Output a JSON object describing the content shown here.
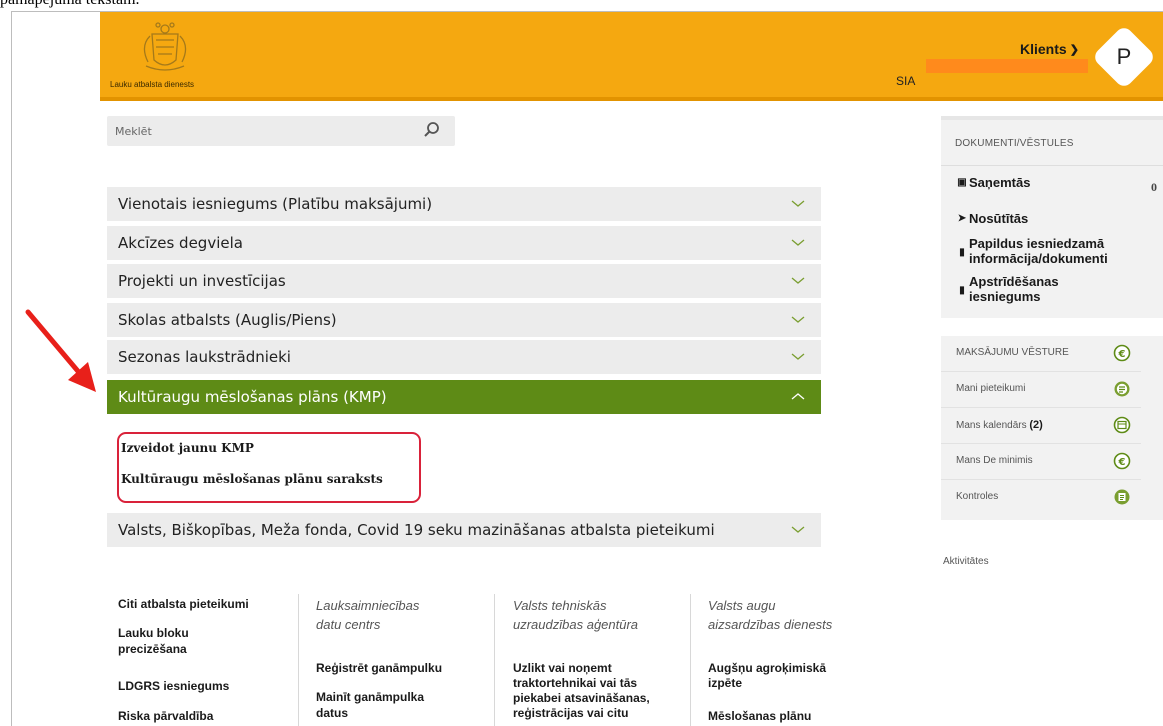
{
  "caption_fragment": "pamapējuma tekstam.",
  "header": {
    "logo_text": "Lauku atbalsta dienests",
    "client_label": "Klients",
    "company_prefix": "SIA",
    "avatar_letter": "P",
    "colors": {
      "bar": "#f5a810",
      "redaction": "#ff8a1c"
    }
  },
  "search": {
    "placeholder": "Meklēt",
    "icon": "search-icon"
  },
  "accordion": [
    {
      "label": "Vienotais iesniegums (Platību maksājumi)",
      "expanded": false
    },
    {
      "label": "Akcīzes degviela",
      "expanded": false
    },
    {
      "label": "Projekti un investīcijas",
      "expanded": false
    },
    {
      "label": "Skolas atbalsts (Auglis/Piens)",
      "expanded": false
    },
    {
      "label": "Sezonas laukstrādnieki",
      "expanded": false
    },
    {
      "label": "Kultūraugu mēslošanas plāns (KMP)",
      "expanded": true
    },
    {
      "label": "Valsts, Biškopības, Meža fonda, Covid 19 seku mazināšanas atbalsta pieteikumi",
      "expanded": false
    }
  ],
  "submenu": {
    "items": [
      "Izveidot jaunu KMP",
      "Kultūraugu mēslošanas plānu saraksts"
    ],
    "highlight_color": "#d9223a"
  },
  "sidebar": {
    "documents": {
      "heading": "DOKUMENTI/VĒSTULES",
      "received": {
        "label": "Saņemtās",
        "count": "0",
        "icon": "inbox-icon"
      },
      "sent": {
        "label": "Nosūtītās",
        "icon": "send-icon"
      },
      "additional": {
        "line1": "Papildus iesniedzamā",
        "line2": "informācija/dokumenti",
        "icon": "document-icon"
      },
      "appeal": {
        "line1": "Apstrīdēšanas",
        "line2": "iesniegums",
        "icon": "document-icon"
      }
    },
    "payments": [
      {
        "label": "MAKSĀJUMU VĒSTURE",
        "icon": "euro-icon"
      },
      {
        "label": "Mani pieteikumi",
        "icon": "list-icon"
      },
      {
        "label": "Mans kalendārs",
        "badge": "(2)",
        "icon": "calendar-icon"
      },
      {
        "label": "Mans De minimis",
        "icon": "euro-icon"
      },
      {
        "label": "Kontroles",
        "icon": "checklist-icon"
      }
    ],
    "activities": "Aktivitātes",
    "accent_color": "#5e8b16"
  },
  "columns": {
    "col1": [
      "Citi atbalsta pieteikumi",
      "Lauku bloku",
      "precizēšana",
      "LDGRS iesniegums",
      "Riska pārvaldība"
    ],
    "col2": {
      "title1": "Lauksaimniecības",
      "title2": "datu centrs",
      "items": [
        "Reģistrēt ganāmpulku",
        "Mainīt ganāmpulka",
        "datus"
      ]
    },
    "col3": {
      "title1": "Valsts tehniskās",
      "title2": "uzraudzības aģentūra",
      "items": [
        "Uzlikt vai noņemt",
        "traktortehnikai vai tās",
        "piekabei atsavināšanas,",
        "reģistrācijas vai citu"
      ]
    },
    "col4": {
      "title1": "Valsts augu",
      "title2": "aizsardzības dienests",
      "items": [
        "Augšņu agroķimiskā",
        "izpēte",
        "Mēslošanas plānu"
      ]
    }
  }
}
